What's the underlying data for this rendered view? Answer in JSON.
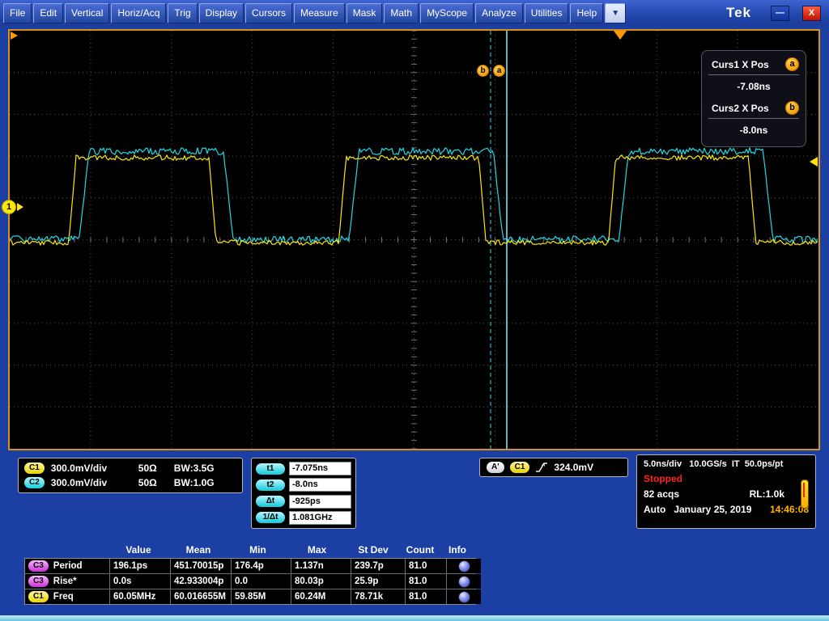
{
  "menu": {
    "items": [
      "File",
      "Edit",
      "Vertical",
      "Horiz/Acq",
      "Trig",
      "Display",
      "Cursors",
      "Measure",
      "Mask",
      "Math",
      "MyScope",
      "Analyze",
      "Utilities",
      "Help"
    ],
    "dropdown_glyph": "▼",
    "brand": "Tek",
    "minimize_glyph": "—",
    "close_glyph": "X"
  },
  "plot": {
    "cursor_a_label": "a",
    "cursor_b_label": "b",
    "ch1_marker": "1"
  },
  "cursor_panel": {
    "curs1_label": "Curs1 X Pos",
    "curs1_badge": "a",
    "curs1_value": "-7.08ns",
    "curs2_label": "Curs2 X Pos",
    "curs2_badge": "b",
    "curs2_value": "-8.0ns"
  },
  "channels": [
    {
      "badge": "C1",
      "scale": "300.0mV/div",
      "impedance": "50Ω",
      "bw": "BW:3.5G"
    },
    {
      "badge": "C2",
      "scale": "300.0mV/div",
      "impedance": "50Ω",
      "bw": "BW:1.0G"
    }
  ],
  "cursor_readout": {
    "rows": [
      {
        "badge": "t1",
        "value": "-7.075ns"
      },
      {
        "badge": "t2",
        "value": "-8.0ns"
      },
      {
        "badge": "Δt",
        "value": "-925ps"
      },
      {
        "badge": "1/Δt",
        "value": "1.081GHz"
      }
    ]
  },
  "trigger": {
    "a_badge": "A'",
    "source_badge": "C1",
    "level": "324.0mV"
  },
  "acquisition": {
    "line1": "5.0ns/div   10.0GS/s  IT  50.0ps/pt",
    "status": "Stopped",
    "acqs": "82 acqs",
    "record_length": "RL:1.0k",
    "mode": "Auto",
    "date": "January 25, 2019",
    "time": "14:46:08"
  },
  "measurements": {
    "headers": [
      "Value",
      "Mean",
      "Min",
      "Max",
      "St Dev",
      "Count",
      "Info"
    ],
    "rows": [
      {
        "badge": "C3",
        "name": "Period",
        "value": "196.1ps",
        "mean": "451.70015p",
        "min": "176.4p",
        "max": "1.137n",
        "stdev": "239.7p",
        "count": "81.0"
      },
      {
        "badge": "C3",
        "name": "Rise*",
        "value": "0.0s",
        "mean": "42.933004p",
        "min": "0.0",
        "max": "80.03p",
        "stdev": "25.9p",
        "count": "81.0"
      },
      {
        "badge": "C1",
        "name": "Freq",
        "value": "60.05MHz",
        "mean": "60.016655M",
        "min": "59.85M",
        "max": "60.24M",
        "stdev": "78.71k",
        "count": "81.0"
      }
    ]
  }
}
